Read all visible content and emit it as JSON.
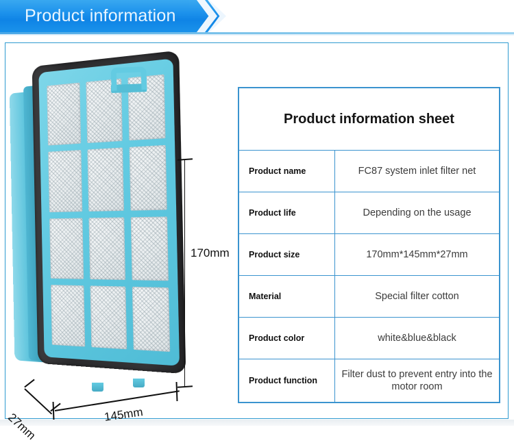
{
  "banner": {
    "title": "Product information",
    "accent_color": "#1e93ec",
    "rule_color": "#7cc3ea",
    "chevron_icon": "chevron-right-icon"
  },
  "product_image": {
    "alt_name": "FC87 system inlet filter net",
    "frame_color": "#2b2b2d",
    "grid_color": "#63cbe2",
    "mesh_color": "#eef2f3",
    "handle_icon": "handle-tab-icon",
    "grid_rows": 4,
    "grid_columns": 3,
    "dimensions": {
      "height": "170mm",
      "width": "145mm",
      "depth": "27mm"
    }
  },
  "info_table": {
    "title": "Product information sheet",
    "border_color": "#3a93cf",
    "rows": [
      {
        "key": "Product name",
        "value": "FC87 system inlet filter net"
      },
      {
        "key": "Product life",
        "value": "Depending on the usage"
      },
      {
        "key": "Product size",
        "value": "170mm*145mm*27mm"
      },
      {
        "key": "Material",
        "value": "Special filter cotton"
      },
      {
        "key": "Product color",
        "value": "white&blue&black"
      },
      {
        "key": "Product function",
        "value": "Filter dust to prevent entry into the motor room"
      }
    ]
  }
}
